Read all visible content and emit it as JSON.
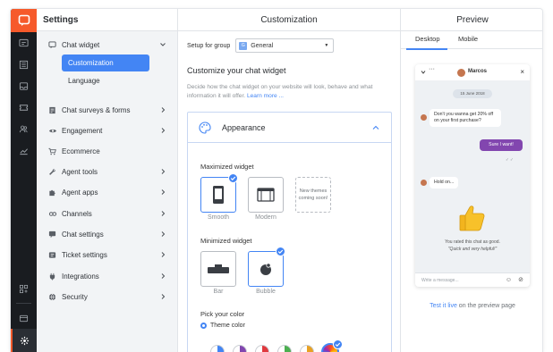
{
  "settings": {
    "title": "Settings",
    "items": [
      {
        "label": "Chat widget"
      },
      {
        "label": "Chat surveys & forms"
      },
      {
        "label": "Engagement"
      },
      {
        "label": "Ecommerce"
      },
      {
        "label": "Agent tools"
      },
      {
        "label": "Agent apps"
      },
      {
        "label": "Channels"
      },
      {
        "label": "Chat settings"
      },
      {
        "label": "Ticket settings"
      },
      {
        "label": "Integrations"
      },
      {
        "label": "Security"
      }
    ],
    "subitems": [
      {
        "label": "Customization",
        "active": true
      },
      {
        "label": "Language",
        "active": false
      }
    ]
  },
  "customization": {
    "title": "Customization",
    "setup_label": "Setup for group",
    "group_badge": "G",
    "group_value": "General",
    "heading": "Customize your chat widget",
    "description": "Decide how the chat widget on your website will look, behave and what information it will offer.",
    "learn_more": "Learn more ...",
    "card_title": "Appearance",
    "maximized_label": "Maximized widget",
    "smooth_label": "Smooth",
    "modern_label": "Modern",
    "new_themes_line1": "New themes",
    "new_themes_line2": "coming soon!",
    "minimized_label": "Minimized widget",
    "bar_label": "Bar",
    "bubble_label": "Bubble",
    "pick_color_label": "Pick your color",
    "theme_color_label": "Theme color"
  },
  "preview": {
    "title": "Preview",
    "tabs": [
      {
        "label": "Desktop"
      },
      {
        "label": "Mobile"
      }
    ],
    "agent_name": "Marcos",
    "date": "15 June 2018",
    "msg1": "Don't you wanna get 20% off on your first purchase?",
    "msg2": "Sure I want!",
    "msg3": "Hold on...",
    "rated_line1": "You rated this chat as good.",
    "rated_line2": "\"Quick and very helpful!\"",
    "input_placeholder": "Write a message...",
    "test_link": "Test it live",
    "test_rest": " on the preview page"
  },
  "colors": {
    "brand": "#f65a2b",
    "accent": "#4385f4",
    "rail_bg": "#191c20",
    "user_bubble": "#8246af"
  }
}
